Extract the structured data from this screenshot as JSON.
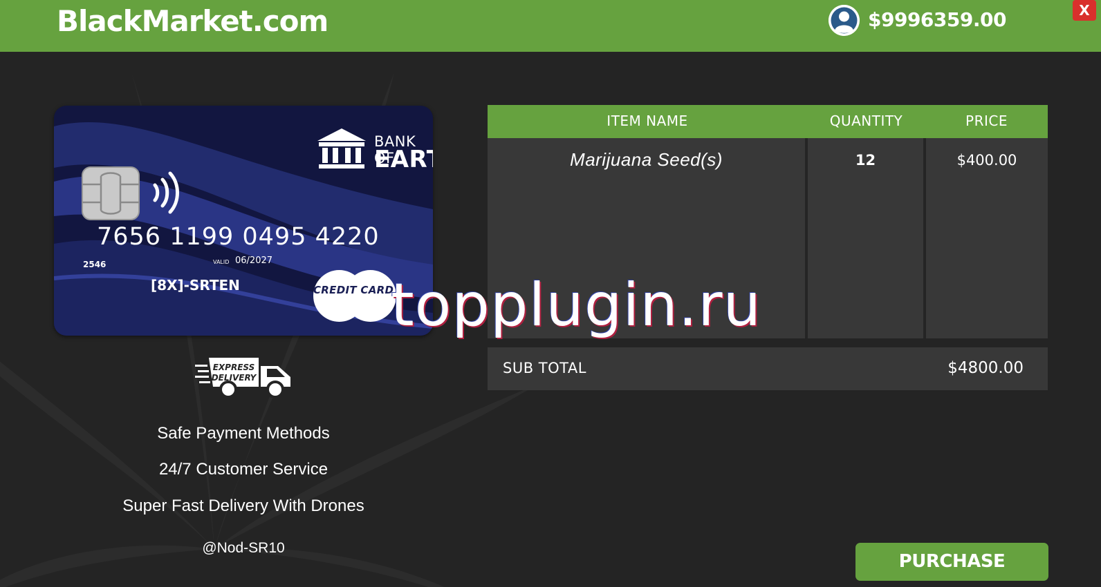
{
  "header": {
    "logo": "BlackMarket.com",
    "balance": "$9996359.00",
    "close_label": "X",
    "avatar_icon": "user-avatar-icon"
  },
  "card": {
    "bank_line1": "BANK OF",
    "bank_line2": "EARTH",
    "number": "7656 1199 0495 4220",
    "cvv": "2546",
    "valid_label": "VALID",
    "valid_date": "06/2027",
    "holder": "[8X]-SRTEN",
    "brand_label": "CREDIT CARD",
    "colors": {
      "background": "#121640",
      "wave": "#2a3585"
    }
  },
  "features": {
    "delivery_icon": "express-delivery-truck-icon",
    "delivery_text_1": "EXPRESS",
    "delivery_text_2": "DELIVERY",
    "items": [
      "Safe Payment Methods",
      "24/7 Customer Service",
      "Super Fast Delivery With Drones"
    ],
    "handle": "@Nod-SR10"
  },
  "table": {
    "headers": [
      "ITEM NAME",
      "QUANTITY",
      "PRICE"
    ],
    "rows": [
      {
        "name": "Marijuana Seed(s)",
        "quantity": "12",
        "price": "$400.00"
      }
    ]
  },
  "subtotal": {
    "label": "SUB TOTAL",
    "value": "$4800.00"
  },
  "purchase_label": "PURCHASE",
  "watermark": "topplugin.ru",
  "colors": {
    "accent": "#66a23f",
    "background": "#242424",
    "panel": "#383838",
    "close": "#d9302c"
  }
}
